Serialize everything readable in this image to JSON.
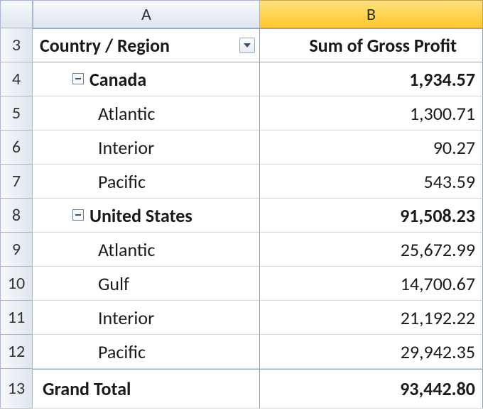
{
  "columns": {
    "A": "A",
    "B": "B"
  },
  "row_numbers": [
    "3",
    "4",
    "5",
    "6",
    "7",
    "8",
    "9",
    "10",
    "11",
    "12",
    "13"
  ],
  "header": {
    "a": "Country / Region",
    "b": "Sum of Gross Profit"
  },
  "groups": [
    {
      "label": "Canada",
      "total": "1,934.57",
      "items": [
        {
          "label": "Atlantic",
          "value": "1,300.71"
        },
        {
          "label": "Interior",
          "value": "90.27"
        },
        {
          "label": "Pacific",
          "value": "543.59"
        }
      ]
    },
    {
      "label": "United States",
      "total": "91,508.23",
      "items": [
        {
          "label": "Atlantic",
          "value": "25,672.99"
        },
        {
          "label": "Gulf",
          "value": "14,700.67"
        },
        {
          "label": "Interior",
          "value": "21,192.22"
        },
        {
          "label": "Pacific",
          "value": "29,942.35"
        }
      ]
    }
  ],
  "grand_total": {
    "label": "Grand Total",
    "value": "93,442.80"
  }
}
